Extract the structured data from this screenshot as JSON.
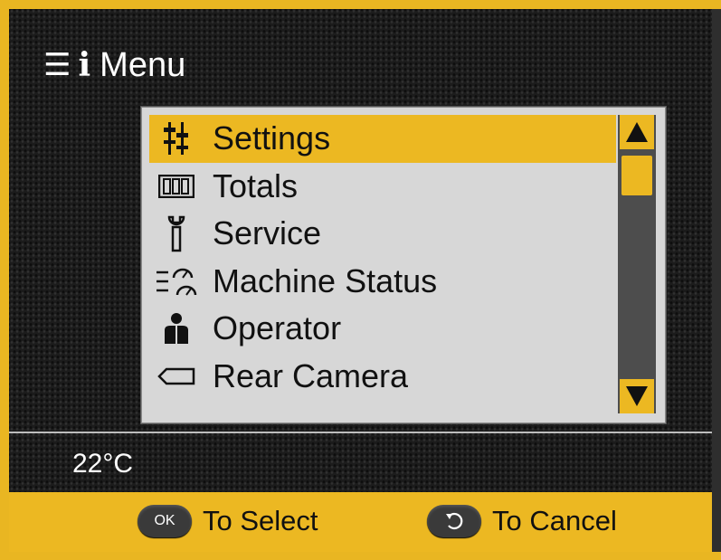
{
  "header": {
    "menu_icon": "menu-list-icon",
    "info_icon": "info-icon",
    "title": "Menu"
  },
  "menu": {
    "selected_index": 0,
    "items": [
      {
        "label": "Settings",
        "icon": "settings-sliders-icon"
      },
      {
        "label": "Totals",
        "icon": "counter-icon"
      },
      {
        "label": "Service",
        "icon": "wrench-icon"
      },
      {
        "label": "Machine Status",
        "icon": "gauges-icon"
      },
      {
        "label": "Operator",
        "icon": "operator-icon"
      },
      {
        "label": "Rear Camera",
        "icon": "camera-icon"
      }
    ]
  },
  "status": {
    "temperature": "22°C"
  },
  "footer": {
    "ok_button_label": "OK",
    "select_label": "To Select",
    "cancel_label": "To Cancel"
  },
  "colors": {
    "accent": "#ecb822",
    "panel": "#d7d7d7",
    "scroll_track": "#4d4d4d",
    "screen_background": "#1c1c1c"
  }
}
